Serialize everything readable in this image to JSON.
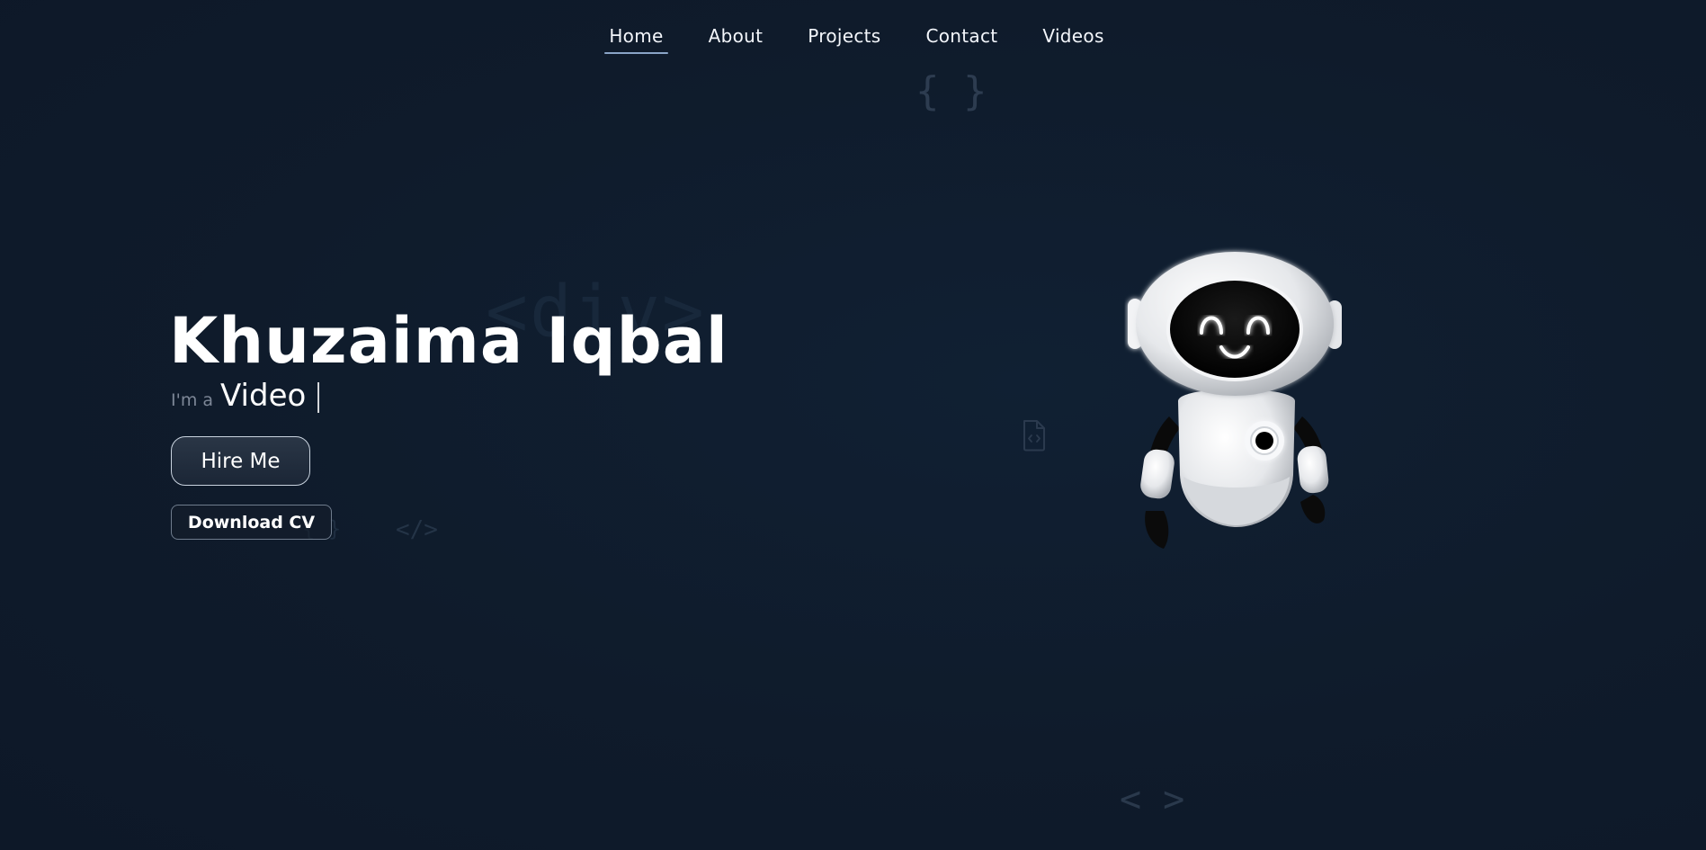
{
  "nav": {
    "items": [
      {
        "label": "Home",
        "active": true
      },
      {
        "label": "About",
        "active": false
      },
      {
        "label": "Projects",
        "active": false
      },
      {
        "label": "Contact",
        "active": false
      },
      {
        "label": "Videos",
        "active": false
      }
    ]
  },
  "hero": {
    "name": "Khuzaima Iqbal",
    "tagline_prefix": "I'm a",
    "tagline_role": "Video",
    "cursor": "|"
  },
  "buttons": {
    "hire_label": "Hire Me",
    "cv_label": "Download CV"
  },
  "decorations": {
    "braces": "{ }",
    "div_tag": "<div>",
    "close_tag": "</>",
    "small_braces": "{ }",
    "angles": "< >",
    "file_icon": "code-file-icon"
  },
  "robot": {
    "icon": "robot-mascot-illustration"
  },
  "colors": {
    "background": "#0f1b2b",
    "accent_underline": "#8aa5c7",
    "text_primary": "#ffffff",
    "text_muted": "#7d8797"
  }
}
